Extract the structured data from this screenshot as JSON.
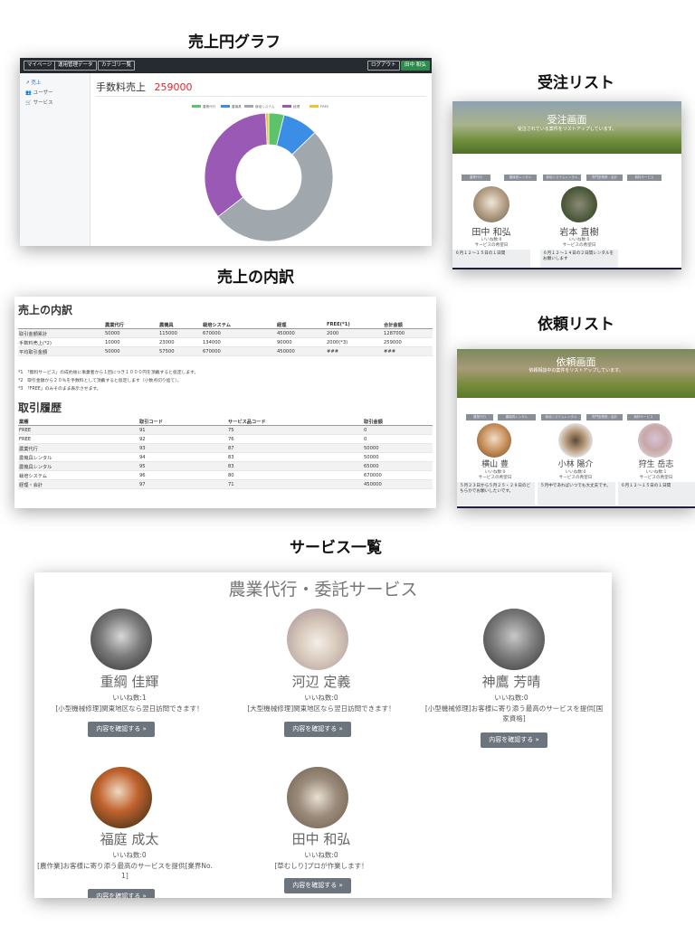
{
  "sections": {
    "sales_graph": "売上円グラフ",
    "order_list": "受注リスト",
    "breakdown": "売上の内訳",
    "request_list": "依頼リスト",
    "service_list": "サービス一覧"
  },
  "sales": {
    "nav_left": [
      "マイページ",
      "運用管理データ",
      "カテゴリ一覧"
    ],
    "logout": "ログアウト",
    "user": "田中 和弘",
    "sidebar": [
      "売上",
      "ユーザー",
      "サービス"
    ],
    "heading_label": "手数料売上",
    "heading_value": "259000"
  },
  "chart_data": {
    "type": "pie",
    "title": "",
    "categories": [
      "農業代行",
      "農機具",
      "栽培システム",
      "経理",
      "FREE"
    ],
    "values": [
      10000,
      23000,
      134000,
      90000,
      2000
    ],
    "colors": [
      "#5cc36b",
      "#3a8ee6",
      "#a0a7ad",
      "#9b59b6",
      "#f1c232"
    ],
    "legend": "top",
    "donut": true
  },
  "orders": {
    "hero_title": "受注画面",
    "hero_sub": "受注されている案件をリストアップしています。",
    "categories": [
      "農業代行",
      "農機具レンタル",
      "栽培システムレンタル",
      "専門型業務・会計",
      "無料サービス"
    ],
    "people": [
      {
        "name": "田中 和弘",
        "likes": "いいね数:0",
        "wish": "サービスの希望日",
        "request": "６月１２～１５日の１日間"
      },
      {
        "name": "岩本 直樹",
        "likes": "いいね数:0",
        "wish": "サービスの希望日",
        "request": "６月１２～１４日の２日間レンタルをお願いします"
      }
    ]
  },
  "requests": {
    "hero_title": "依頼画面",
    "hero_sub": "依頼相談中の案件をリストアップしています。",
    "categories": [
      "農業代行",
      "農機具レンタル",
      "栽培システムレンタル",
      "専門型業務・会計",
      "無料サービス"
    ],
    "people": [
      {
        "name": "横山 豊",
        "likes": "いいね数:0",
        "wish": "サービスの希望日",
        "request": "５月２３日から５月２５・２９日のどちらかでお願いしたいです。"
      },
      {
        "name": "小林 陽介",
        "likes": "いいね数:0",
        "wish": "サービスの希望日",
        "request": "５月中であればいつでも大丈夫です。"
      },
      {
        "name": "狩生 岳志",
        "likes": "いいね数:1",
        "wish": "サービスの希望日",
        "request": "６月１２～１５日の１日間"
      }
    ]
  },
  "breakdown": {
    "heading": "売上の内訳",
    "columns": [
      "",
      "農業代行",
      "農機具",
      "栽培システム",
      "経理",
      "FREE(*1)",
      "合計金額"
    ],
    "rows": [
      [
        "取引金額累計",
        "50000",
        "115000",
        "670000",
        "450000",
        "2000",
        "1287000"
      ],
      [
        "手数料売上(*2)",
        "10000",
        "23000",
        "134000",
        "90000",
        "2000(*3)",
        "259000"
      ],
      [
        "平均取引金額",
        "50000",
        "57500",
        "670000",
        "450000",
        "###",
        "###"
      ]
    ],
    "notes": [
      "*1　「無料サービス」の成約後に事業者から１回につき１０００円を頂戴すると仮定します。",
      "*2　取引金額から２０％を手数料として頂戴すると仮定します（小数点切り捨て）。",
      "*3　「FREE」のみそのまま表示させます。"
    ],
    "history_heading": "取引履歴",
    "history_columns": [
      "業種",
      "取引コード",
      "サービス品コード",
      "取引金額"
    ],
    "history_rows": [
      [
        "FREE",
        "91",
        "75",
        "0"
      ],
      [
        "FREE",
        "92",
        "76",
        "0"
      ],
      [
        "農業代行",
        "93",
        "87",
        "50000"
      ],
      [
        "農機具レンタル",
        "94",
        "83",
        "50000"
      ],
      [
        "農機具レンタル",
        "95",
        "83",
        "65000"
      ],
      [
        "栽培システム",
        "96",
        "80",
        "670000"
      ],
      [
        "経理・会計",
        "97",
        "71",
        "450000"
      ]
    ]
  },
  "services": {
    "title": "農業代行・委託サービス",
    "button_label": "内容を確認する »",
    "cards": [
      {
        "name": "重綱 佳輝",
        "likes": "いいね数:1",
        "desc": "[小型機械修理]関東地区なら翌日訪問できます！"
      },
      {
        "name": "河辺 定義",
        "likes": "いいね数:0",
        "desc": "[大型機械修理]関東地区なら翌日訪問できます！"
      },
      {
        "name": "神鷹 芳晴",
        "likes": "いいね数:0",
        "desc": "[小型機械修理]お客様に寄り添う最高のサービスを提供[国家資格]"
      },
      {
        "name": "福庭 成太",
        "likes": "いいね数:0",
        "desc": "[農作業]お客様に寄り添う最高のサービスを提供[業界No. 1]"
      },
      {
        "name": "田中 和弘",
        "likes": "いいね数:0",
        "desc": "[草むしり]プロが作業します！"
      }
    ]
  }
}
